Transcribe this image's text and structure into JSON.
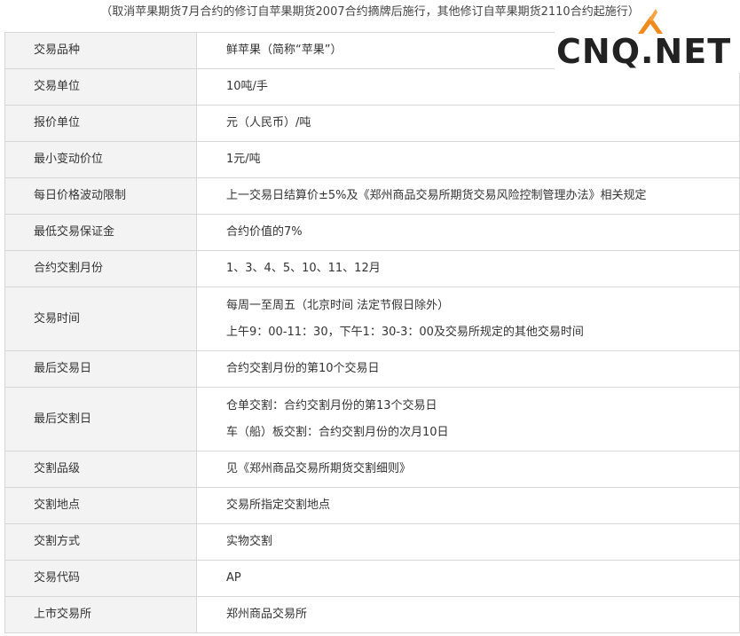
{
  "note": "（取消苹果期货7月合约的修订自苹果期货2007合约摘牌后施行，其他修订自苹果期货2110合约起施行）",
  "logo": {
    "text": "CNQ.NET",
    "accent": "#f08a1c"
  },
  "rows": [
    {
      "label": "交易品种",
      "value": "鲜苹果（简称“苹果”）"
    },
    {
      "label": "交易单位",
      "value": "10吨/手"
    },
    {
      "label": "报价单位",
      "value": "元（人民币）/吨"
    },
    {
      "label": "最小变动价位",
      "value": "1元/吨"
    },
    {
      "label": "每日价格波动限制",
      "value": "上一交易日结算价±5%及《郑州商品交易所期货交易风险控制管理办法》相关规定"
    },
    {
      "label": "最低交易保证金",
      "value": "合约价值的7%"
    },
    {
      "label": "合约交割月份",
      "value": "1、3、4、5、10、11、12月"
    },
    {
      "label": "交易时间",
      "value": "每周一至周五（北京时间 法定节假日除外）",
      "value2": "上午9：00-11：30，下午1：30-3：00及交易所规定的其他交易时间"
    },
    {
      "label": "最后交易日",
      "value": "合约交割月份的第10个交易日"
    },
    {
      "label": "最后交割日",
      "value": "仓单交割：合约交割月份的第13个交易日",
      "value2": "车（船）板交割：合约交割月份的次月10日"
    },
    {
      "label": "交割品级",
      "value": "见《郑州商品交易所期货交割细则》"
    },
    {
      "label": "交割地点",
      "value": "交易所指定交割地点"
    },
    {
      "label": "交割方式",
      "value": "实物交割"
    },
    {
      "label": "交易代码",
      "value": "AP"
    },
    {
      "label": "上市交易所",
      "value": "郑州商品交易所"
    }
  ]
}
